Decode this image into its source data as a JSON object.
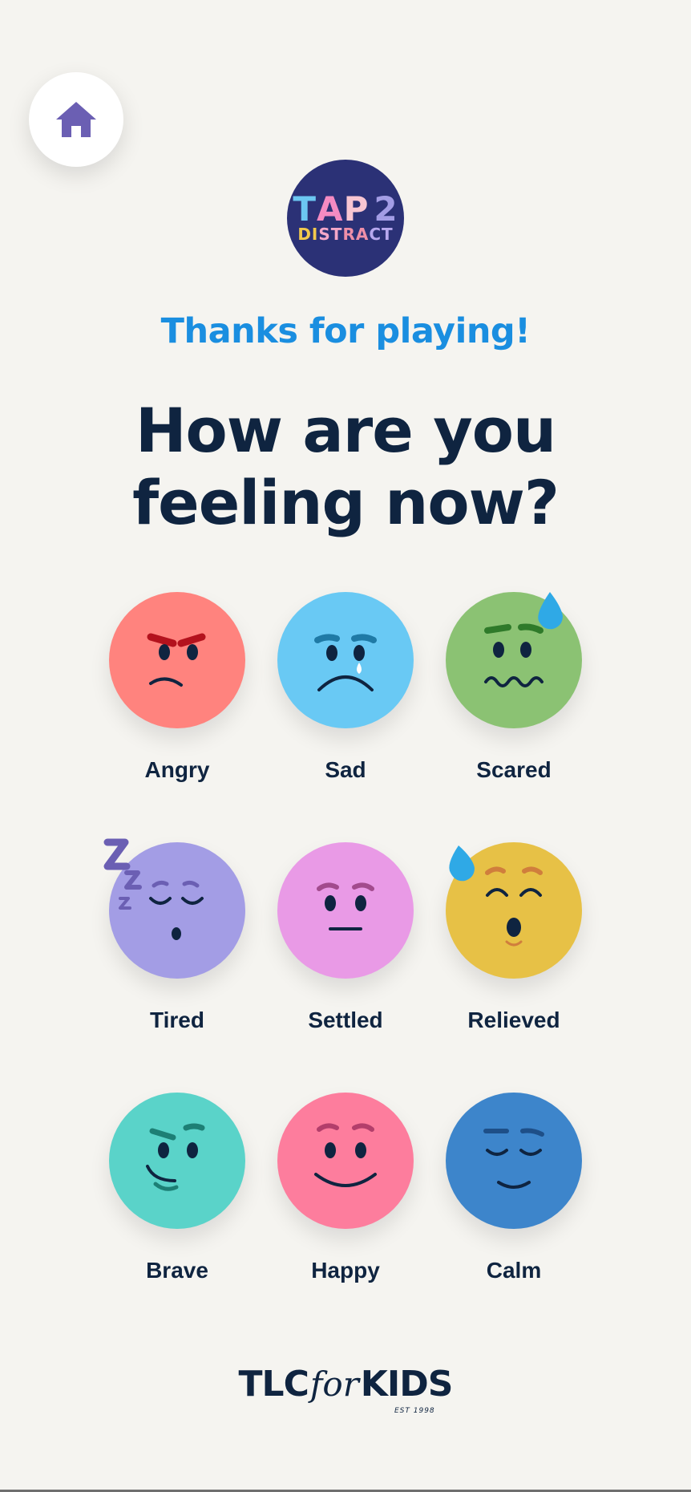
{
  "logo": {
    "line1": [
      "T",
      "A",
      "P",
      "2"
    ],
    "line2": [
      "D",
      "I",
      "S",
      "T",
      "R",
      "A",
      "C",
      "T"
    ]
  },
  "thanks_text": "Thanks for playing!",
  "heading_line1": "How are you",
  "heading_line2": "feeling now?",
  "emotions": [
    {
      "label": "Angry",
      "color": "#ff837e"
    },
    {
      "label": "Sad",
      "color": "#69c9f4"
    },
    {
      "label": "Scared",
      "color": "#8bc273"
    },
    {
      "label": "Tired",
      "color": "#a39de5"
    },
    {
      "label": "Settled",
      "color": "#e99ae6"
    },
    {
      "label": "Relieved",
      "color": "#e7c146"
    },
    {
      "label": "Brave",
      "color": "#5ad3c9"
    },
    {
      "label": "Happy",
      "color": "#fd7d9d"
    },
    {
      "label": "Calm",
      "color": "#3d85cb"
    }
  ],
  "brand": {
    "left": "TLC",
    "middle": "for",
    "right": "KIDS",
    "est": "EST 1998"
  },
  "colors": {
    "accent": "#1a8ee0",
    "text_dark": "#0f2440",
    "home_icon": "#6b5fb3"
  }
}
